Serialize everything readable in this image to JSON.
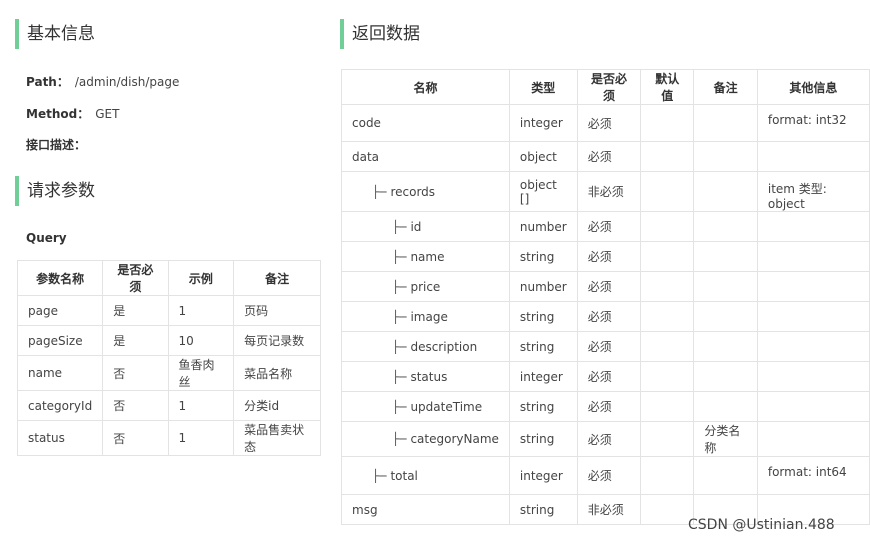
{
  "basic": {
    "title": "基本信息",
    "path_label": "Path：",
    "path_value": "/admin/dish/page",
    "method_label": "Method：",
    "method_value": "GET",
    "desc_label": "接口描述："
  },
  "request": {
    "title": "请求参数",
    "query_label": "Query",
    "headers": [
      "参数名称",
      "是否必须",
      "示例",
      "备注"
    ],
    "rows": [
      [
        "page",
        "是",
        "1",
        "页码"
      ],
      [
        "pageSize",
        "是",
        "10",
        "每页记录数"
      ],
      [
        "name",
        "否",
        "鱼香肉丝",
        "菜品名称"
      ],
      [
        "categoryId",
        "否",
        "1",
        "分类id"
      ],
      [
        "status",
        "否",
        "1",
        "菜品售卖状态"
      ]
    ]
  },
  "response": {
    "title": "返回数据",
    "headers": [
      "名称",
      "类型",
      "是否必须",
      "默认值",
      "备注",
      "其他信息"
    ],
    "tree_branch": "├─",
    "rows": [
      {
        "name": "code",
        "level": 0,
        "type": "integer",
        "required": "必须",
        "default": "",
        "note": "",
        "other": "format: int32"
      },
      {
        "name": "data",
        "level": 0,
        "type": "object",
        "required": "必须",
        "default": "",
        "note": "",
        "other": ""
      },
      {
        "name": "records",
        "level": 1,
        "type": "object []",
        "required": "非必须",
        "default": "",
        "note": "",
        "other": "item 类型: object"
      },
      {
        "name": "id",
        "level": 2,
        "type": "number",
        "required": "必须",
        "default": "",
        "note": "",
        "other": ""
      },
      {
        "name": "name",
        "level": 2,
        "type": "string",
        "required": "必须",
        "default": "",
        "note": "",
        "other": ""
      },
      {
        "name": "price",
        "level": 2,
        "type": "number",
        "required": "必须",
        "default": "",
        "note": "",
        "other": ""
      },
      {
        "name": "image",
        "level": 2,
        "type": "string",
        "required": "必须",
        "default": "",
        "note": "",
        "other": ""
      },
      {
        "name": "description",
        "level": 2,
        "type": "string",
        "required": "必须",
        "default": "",
        "note": "",
        "other": ""
      },
      {
        "name": "status",
        "level": 2,
        "type": "integer",
        "required": "必须",
        "default": "",
        "note": "",
        "other": ""
      },
      {
        "name": "updateTime",
        "level": 2,
        "type": "string",
        "required": "必须",
        "default": "",
        "note": "",
        "other": ""
      },
      {
        "name": "categoryName",
        "level": 2,
        "type": "string",
        "required": "必须",
        "default": "",
        "note": "分类名称",
        "other": ""
      },
      {
        "name": "total",
        "level": 1,
        "type": "integer",
        "required": "必须",
        "default": "",
        "note": "",
        "other": "format: int64"
      },
      {
        "name": "msg",
        "level": 0,
        "type": "string",
        "required": "非必须",
        "default": "",
        "note": "",
        "other": ""
      }
    ]
  },
  "watermark": "CSDN @Ustinian.488"
}
